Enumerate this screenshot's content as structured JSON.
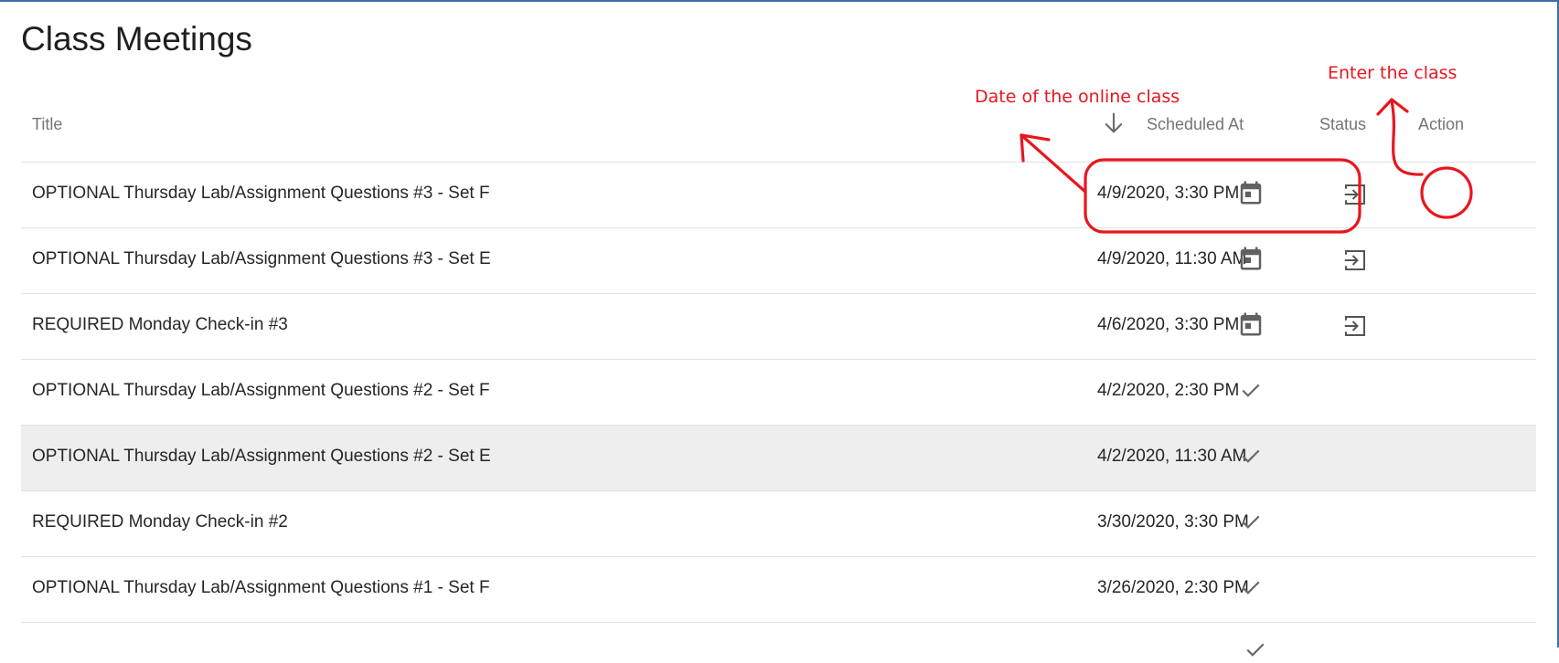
{
  "page": {
    "title": "Class Meetings"
  },
  "table": {
    "columns": {
      "title": "Title",
      "scheduled_at": "Scheduled At",
      "status": "Status",
      "action": "Action"
    },
    "sort": {
      "column": "Scheduled At",
      "direction": "descending",
      "icon": "arrow-down-icon"
    },
    "rows": [
      {
        "title": "OPTIONAL Thursday Lab/Assignment Questions #3 - Set F",
        "scheduled_at": "4/9/2020, 3:30 PM",
        "status": "scheduled",
        "status_icon": "calendar-icon",
        "action_icon": "enter-icon"
      },
      {
        "title": "OPTIONAL Thursday Lab/Assignment Questions #3 - Set E",
        "scheduled_at": "4/9/2020, 11:30 AM",
        "status": "scheduled",
        "status_icon": "calendar-icon",
        "action_icon": "enter-icon"
      },
      {
        "title": "REQUIRED Monday Check-in #3",
        "scheduled_at": "4/6/2020, 3:30 PM",
        "status": "scheduled",
        "status_icon": "calendar-icon",
        "action_icon": "enter-icon"
      },
      {
        "title": "OPTIONAL Thursday Lab/Assignment Questions #2 - Set F",
        "scheduled_at": "4/2/2020, 2:30 PM",
        "status": "completed",
        "status_icon": "check-icon"
      },
      {
        "title": "OPTIONAL Thursday Lab/Assignment Questions #2 - Set E",
        "scheduled_at": "4/2/2020, 11:30 AM",
        "status": "completed",
        "status_icon": "check-icon"
      },
      {
        "title": "REQUIRED Monday Check-in #2",
        "scheduled_at": "3/30/2020, 3:30 PM",
        "status": "completed",
        "status_icon": "check-icon"
      },
      {
        "title": "OPTIONAL Thursday Lab/Assignment Questions #1 - Set F",
        "scheduled_at": "3/26/2020, 2:30 PM",
        "status": "completed",
        "status_icon": "check-icon"
      }
    ]
  },
  "annotations": {
    "date_label": "Date of the online class",
    "enter_label": "Enter the class",
    "color": "#e8161f"
  },
  "colors": {
    "frame": "#3b6fa8",
    "row_hover": "#eeeeee",
    "divider": "#e2e2e2",
    "icon": "#616161"
  }
}
